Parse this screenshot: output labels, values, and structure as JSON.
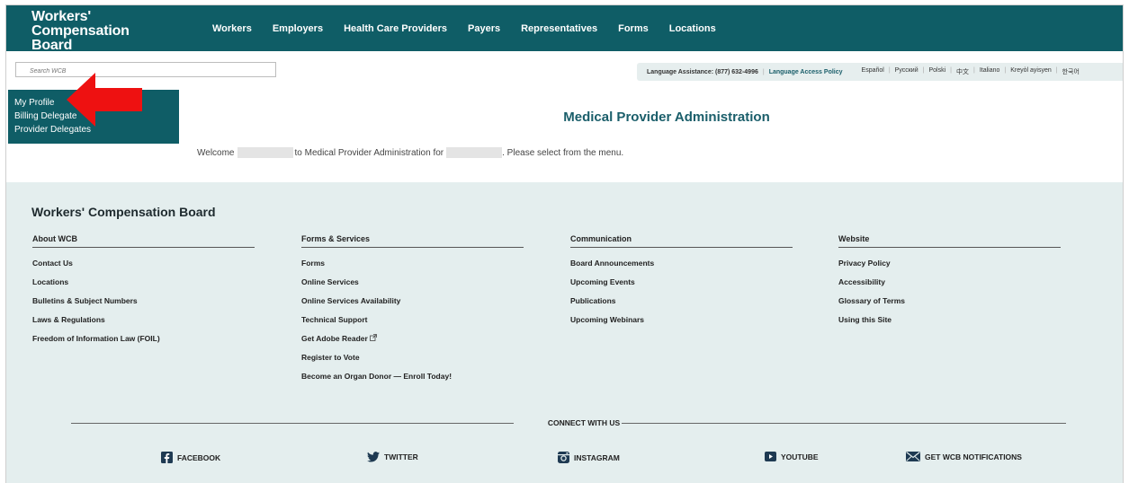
{
  "header": {
    "logo_line1": "Workers'",
    "logo_line2": "Compensation Board",
    "nav": [
      "Workers",
      "Employers",
      "Health Care Providers",
      "Payers",
      "Representatives",
      "Forms",
      "Locations"
    ]
  },
  "search": {
    "placeholder": "Search WCB"
  },
  "language_bar": {
    "label": "Language Assistance: (877) 632-4996",
    "policy": "Language Access Policy",
    "languages": [
      "Español",
      "Русский",
      "Polski",
      "中文",
      "Italiano",
      "Kreyòl ayisyen",
      "한국어"
    ]
  },
  "sidemenu": {
    "items": [
      "My Profile",
      "Billing Delegate",
      "Provider Delegates"
    ]
  },
  "main": {
    "title": "Medical Provider Administration",
    "welcome_prefix": "Welcome",
    "welcome_middle": "to Medical Provider Administration for",
    "welcome_suffix": ". Please select from the menu."
  },
  "footer": {
    "title": "Workers' Compensation Board",
    "columns": [
      {
        "heading": "About WCB",
        "links": [
          "Contact Us",
          "Locations",
          "Bulletins & Subject Numbers",
          "Laws & Regulations",
          "Freedom of Information Law (FOIL)"
        ]
      },
      {
        "heading": "Forms & Services",
        "links": [
          "Forms",
          "Online Services",
          "Online Services Availability",
          "Technical Support",
          "Get Adobe Reader",
          "Register to Vote",
          "Become an Organ Donor — Enroll Today!"
        ]
      },
      {
        "heading": "Communication",
        "links": [
          "Board Announcements",
          "Upcoming Events",
          "Publications",
          "Upcoming Webinars"
        ]
      },
      {
        "heading": "Website",
        "links": [
          "Privacy Policy",
          "Accessibility",
          "Glossary of Terms",
          "Using this Site"
        ]
      }
    ],
    "connect_label": "CONNECT WITH US",
    "social": [
      "FACEBOOK",
      "TWITTER",
      "INSTAGRAM",
      "YOUTUBE",
      "GET WCB NOTIFICATIONS"
    ]
  },
  "colors": {
    "brand_teal": "#0f5d66",
    "footer_bg": "#e4eeee",
    "arrow_red": "#ee1111"
  }
}
